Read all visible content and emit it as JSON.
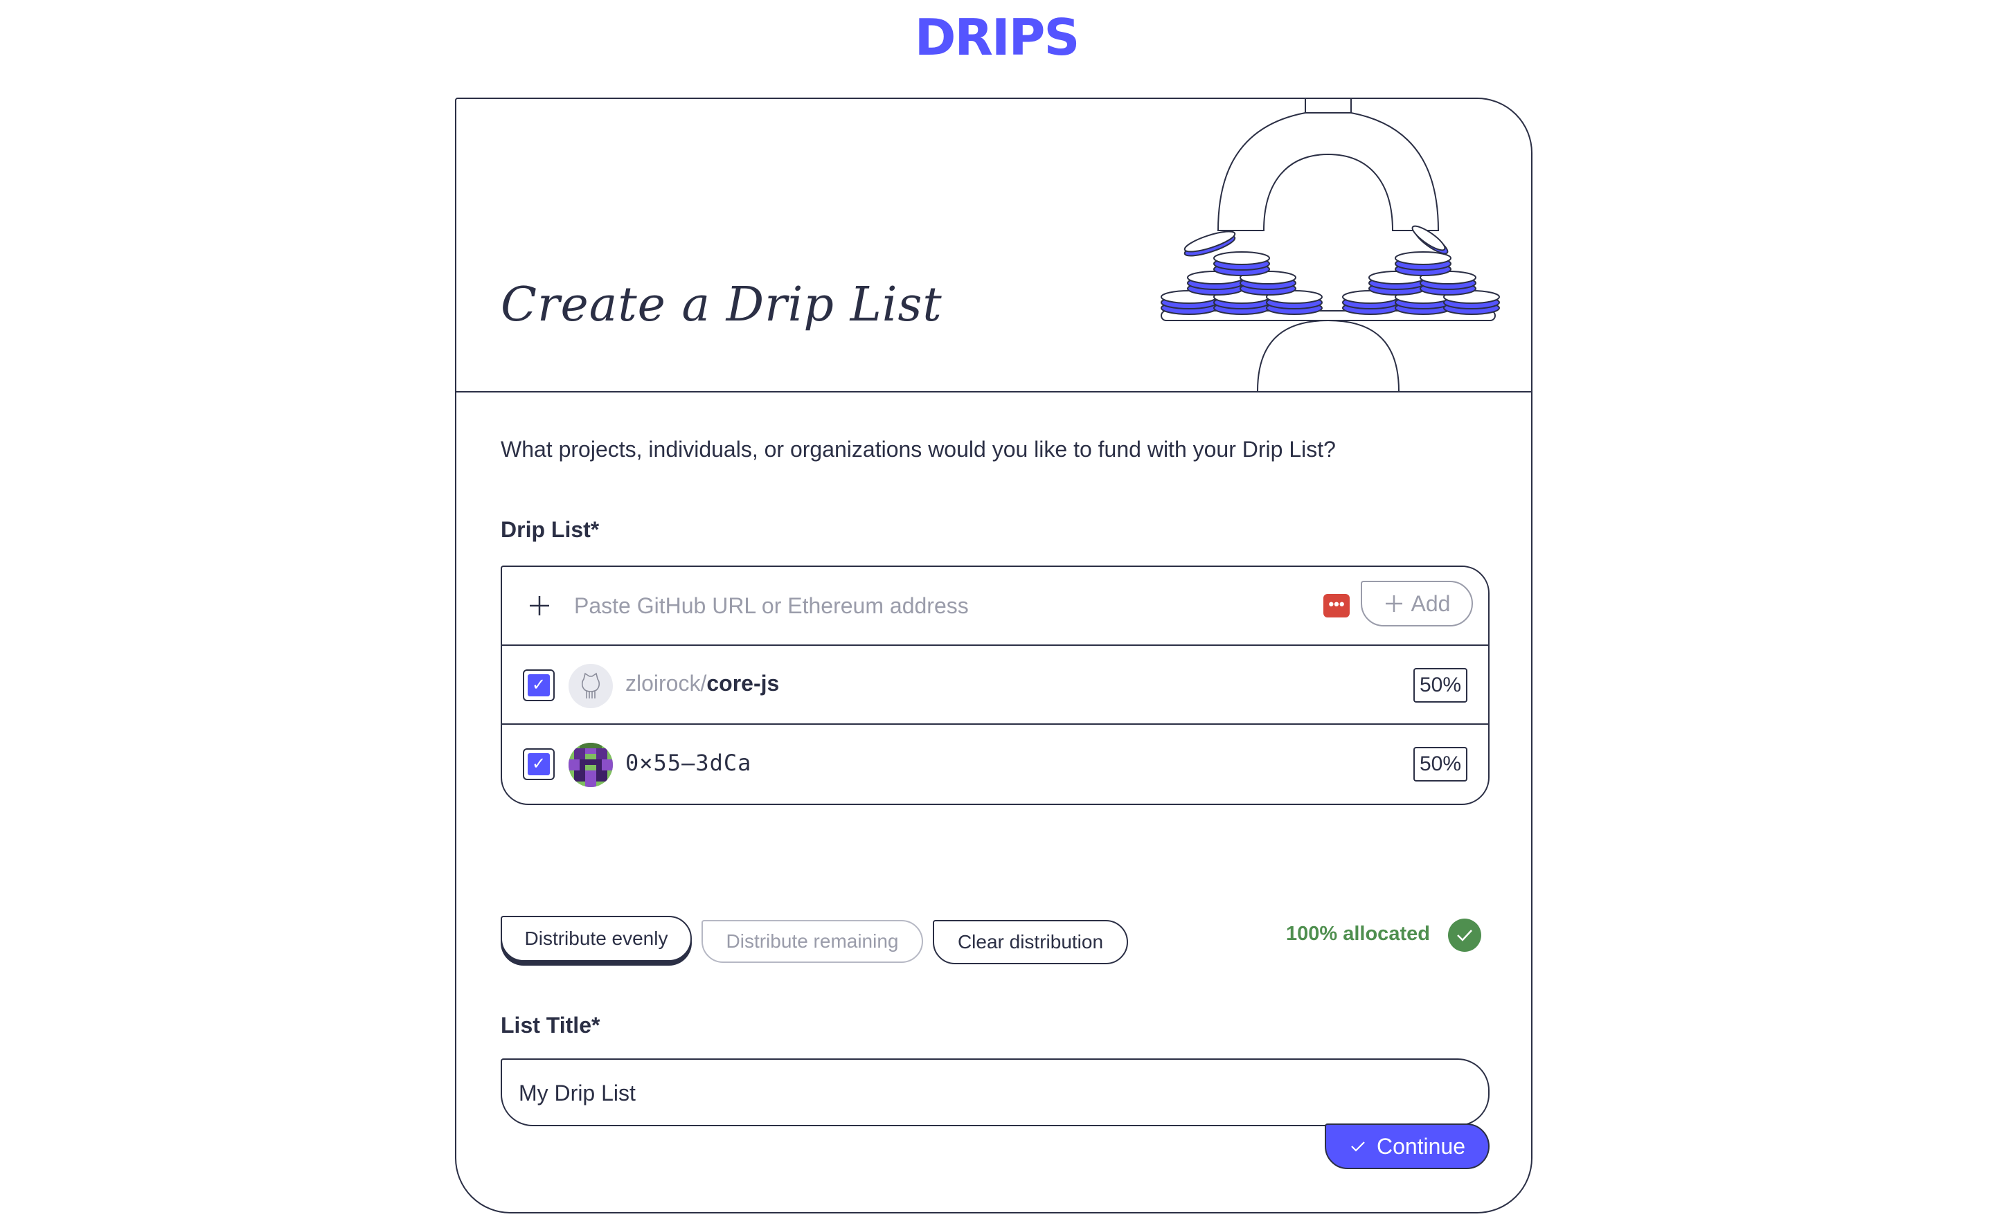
{
  "brand": {
    "logo_text": "DRIPS",
    "accent": "#5555ff",
    "ink": "#2b2f45",
    "success": "#4f8f4f"
  },
  "hero": {
    "title": "Create a Drip List",
    "illustration": "coin-stacks-scale"
  },
  "form": {
    "question": "What projects, individuals, or organizations would you like to fund with your Drip List?",
    "drip_list_label": "Drip List*",
    "search": {
      "placeholder": "Paste GitHub URL or Ethereum address",
      "value": "",
      "add_label": "Add"
    },
    "recipients": [
      {
        "type": "github",
        "owner": "zloirock/",
        "repo": "core-js",
        "percent": "50%",
        "checked": true,
        "icon": "github-icon"
      },
      {
        "type": "address",
        "address": "0×55—3dCa",
        "percent": "50%",
        "checked": true,
        "icon": "pixel-avatar"
      }
    ],
    "actions": {
      "distribute_evenly": "Distribute evenly",
      "distribute_remaining": "Distribute remaining",
      "clear_distribution": "Clear distribution"
    },
    "allocation_status": "100% allocated",
    "list_title_label": "List Title*",
    "list_title_value": "My Drip List",
    "continue_label": "Continue"
  }
}
